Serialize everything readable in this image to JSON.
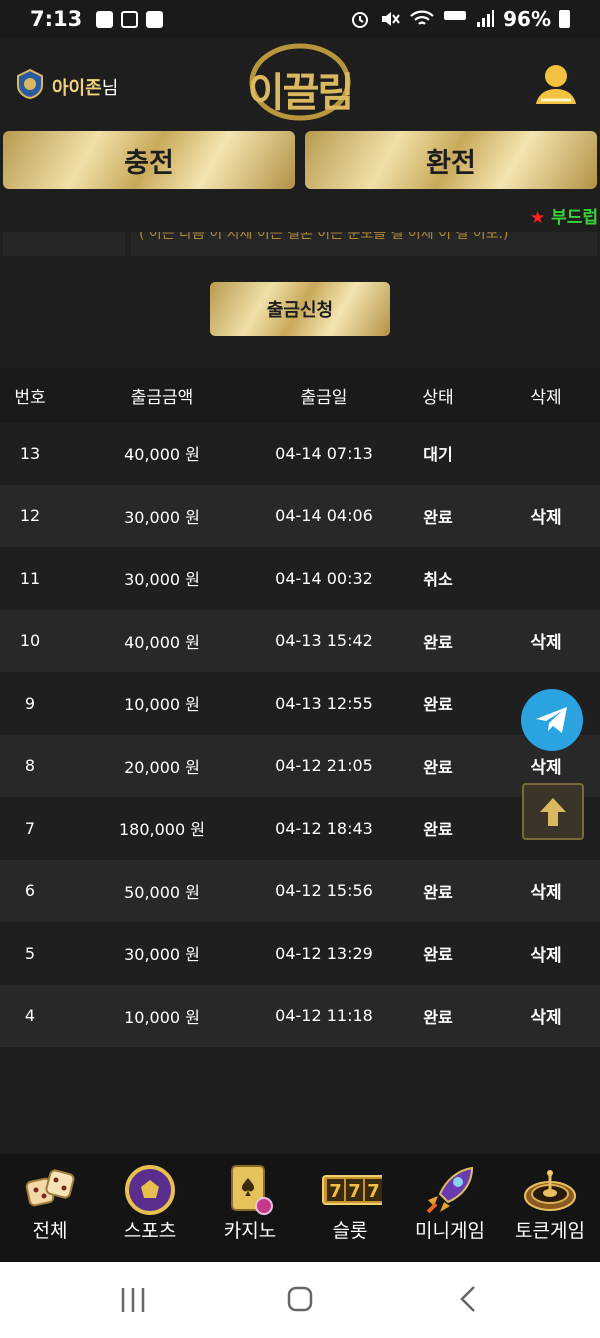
{
  "status_bar": {
    "time": "7:13",
    "battery": "96%"
  },
  "header": {
    "user_name": "아이존",
    "user_suffix": "님",
    "logo_text": "이끌림"
  },
  "actions": {
    "charge": "충전",
    "exchange": "환전"
  },
  "ticker": {
    "star": "★",
    "text": "부드럽"
  },
  "notice": {
    "text": "( 이는 다음 이 지제 이는 결론 이는 문모를 결 이제 이 결 이모.)"
  },
  "withdraw_button": "출금신청",
  "table": {
    "headers": [
      "번호",
      "출금금액",
      "출금일",
      "상태",
      "삭제"
    ],
    "rows": [
      {
        "no": "13",
        "amount": "40,000 원",
        "date": "04-14 07:13",
        "status": "대기",
        "delete": ""
      },
      {
        "no": "12",
        "amount": "30,000 원",
        "date": "04-14 04:06",
        "status": "완료",
        "delete": "삭제"
      },
      {
        "no": "11",
        "amount": "30,000 원",
        "date": "04-14 00:32",
        "status": "취소",
        "delete": ""
      },
      {
        "no": "10",
        "amount": "40,000 원",
        "date": "04-13 15:42",
        "status": "완료",
        "delete": "삭제"
      },
      {
        "no": "9",
        "amount": "10,000 원",
        "date": "04-13 12:55",
        "status": "완료",
        "delete": ""
      },
      {
        "no": "8",
        "amount": "20,000 원",
        "date": "04-12 21:05",
        "status": "완료",
        "delete": "삭제"
      },
      {
        "no": "7",
        "amount": "180,000 원",
        "date": "04-12 18:43",
        "status": "완료",
        "delete": ""
      },
      {
        "no": "6",
        "amount": "50,000 원",
        "date": "04-12 15:56",
        "status": "완료",
        "delete": "삭제"
      },
      {
        "no": "5",
        "amount": "30,000 원",
        "date": "04-12 13:29",
        "status": "완료",
        "delete": "삭제"
      },
      {
        "no": "4",
        "amount": "10,000 원",
        "date": "04-12 11:18",
        "status": "완료",
        "delete": "삭제"
      }
    ]
  },
  "bottom_nav": [
    {
      "label": "전체",
      "icon": "dice-icon"
    },
    {
      "label": "스포츠",
      "icon": "soccer-ball-icon"
    },
    {
      "label": "카지노",
      "icon": "playing-cards-icon"
    },
    {
      "label": "슬롯",
      "icon": "slot-777-icon"
    },
    {
      "label": "미니게임",
      "icon": "rocket-icon"
    },
    {
      "label": "토큰게임",
      "icon": "roulette-icon"
    }
  ],
  "colors": {
    "gold": "#d9b860",
    "accent_green": "#3ad13a",
    "telegram": "#2aa3e0"
  }
}
